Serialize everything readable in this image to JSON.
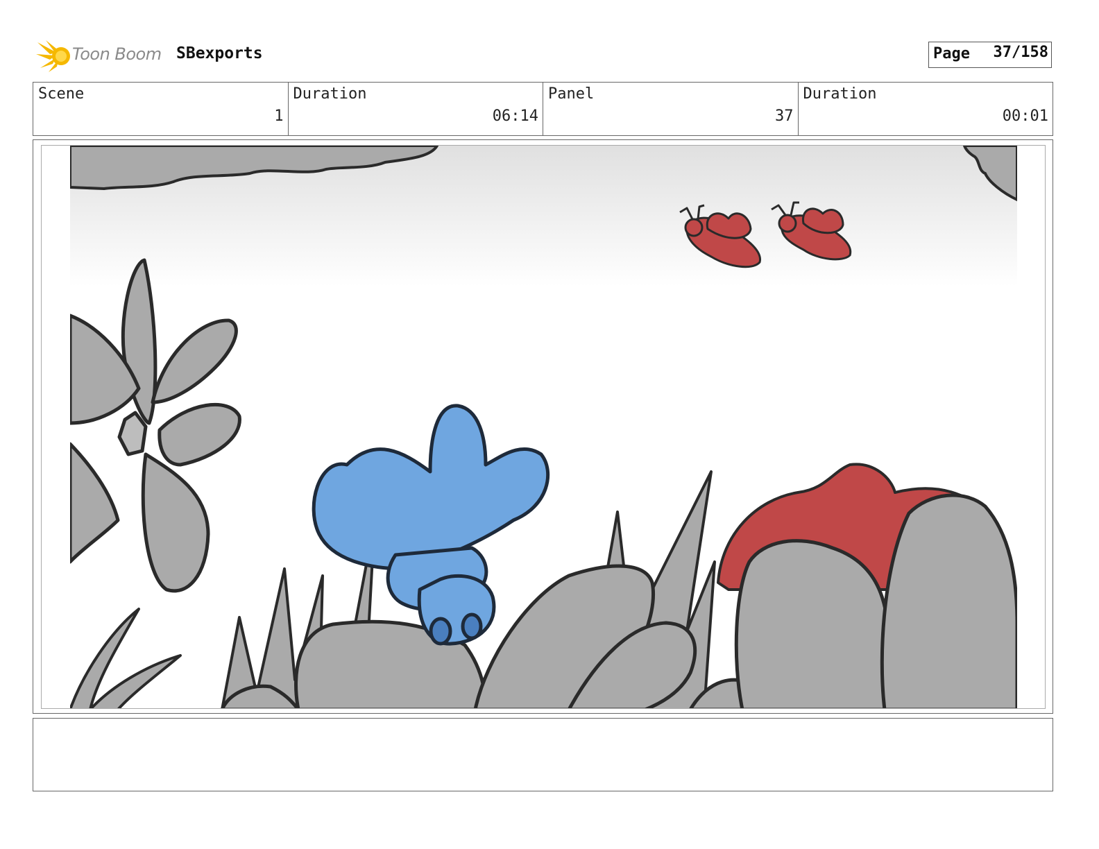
{
  "header": {
    "logo_text": "Toon Boom",
    "project_name": "SBexports",
    "page_label": "Page",
    "page_value": "37/158"
  },
  "info": {
    "scene_label": "Scene",
    "scene_value": "1",
    "scene_duration_label": "Duration",
    "scene_duration_value": "06:14",
    "panel_label": "Panel",
    "panel_value": "37",
    "panel_duration_label": "Duration",
    "panel_duration_value": "00:01"
  },
  "notes": {
    "text": ""
  },
  "colors": {
    "logo_yellow": "#f5b800",
    "sky_grey": "#e2e2e2",
    "plant_grey": "#aaaaaa",
    "outline": "#2a2a2a",
    "character_blue": "#6fa6e0",
    "flower_red": "#c04848"
  }
}
